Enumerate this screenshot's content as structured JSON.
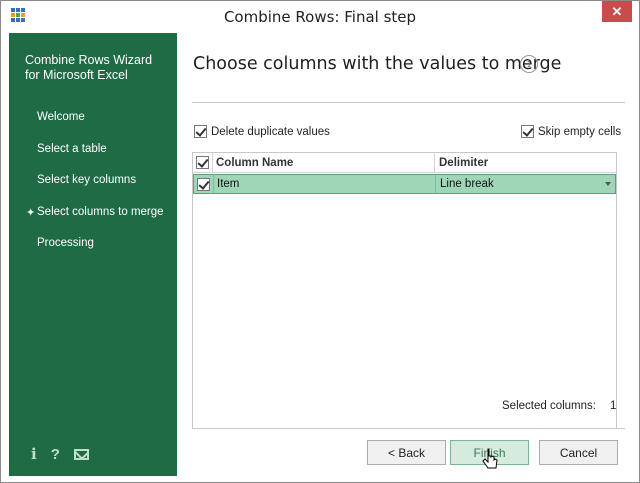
{
  "window": {
    "title": "Combine Rows: Final step",
    "close_glyph": "✕",
    "app_icon": "table-app-icon"
  },
  "sidebar": {
    "title_line1": "Combine Rows Wizard",
    "title_line2": "for Microsoft Excel",
    "current_marker": "✦",
    "items": [
      {
        "label": "Welcome",
        "current": false
      },
      {
        "label": "Select a table",
        "current": false
      },
      {
        "label": "Select key columns",
        "current": false
      },
      {
        "label": "Select columns to merge",
        "current": true
      },
      {
        "label": "Processing",
        "current": false
      }
    ],
    "footer_icons": [
      "info-icon",
      "help-icon",
      "mail-icon"
    ],
    "info_glyph": "i",
    "help_glyph": "?"
  },
  "main": {
    "heading": "Choose columns with the values to merge",
    "info_glyph": "i",
    "options": {
      "delete_duplicates": {
        "label": "Delete duplicate values",
        "checked": true
      },
      "skip_empty": {
        "label": "Skip empty cells",
        "checked": true
      }
    },
    "grid": {
      "columns": [
        "Column Name",
        "Delimiter"
      ],
      "rows": [
        {
          "checked": true,
          "name": "Item",
          "delimiter": "Line break"
        }
      ]
    },
    "selected_columns_label": "Selected columns:",
    "selected_columns_count": "1"
  },
  "buttons": {
    "back": "< Back",
    "finish": "Finish",
    "cancel": "Cancel"
  },
  "colors": {
    "sidebar_bg": "#1e6b45",
    "row_highlight": "#9fd6b8",
    "close_button": "#c94c4c"
  }
}
